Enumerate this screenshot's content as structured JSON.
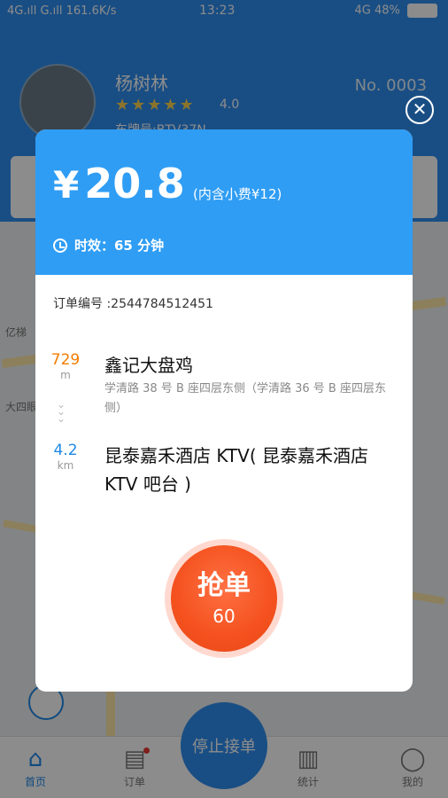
{
  "status_bar": {
    "network": "4G.ıll G.ıll 161.6K/s",
    "time": "13:23",
    "signal": "4G",
    "battery": "48%"
  },
  "driver": {
    "name": "杨树林",
    "rating": "4.0",
    "plate": "车牌号:BTV37N",
    "number": "No. 0003"
  },
  "nav": {
    "home": "首页",
    "orders": "订单",
    "stats": "统计",
    "mine": "我的",
    "stop": "停止接单"
  },
  "map_labels": {
    "a": "大四眼",
    "b": "亿梯"
  },
  "modal": {
    "currency": "¥",
    "price": "20.8",
    "tip": "(内含小费¥12)",
    "duration": "时效：65 分钟",
    "order_no": "订单编号 :2544784512451",
    "pickup": {
      "distance": "729",
      "unit": "m",
      "title": "鑫记大盘鸡",
      "address": "学清路 38 号 B 座四层东侧（学清路 36 号 B 座四层东侧）"
    },
    "dropoff": {
      "distance": "4.2",
      "unit": "km",
      "title": "昆泰嘉禾酒店 KTV( 昆泰嘉禾酒店 KTV 吧台 )"
    },
    "grab_label": "抢单",
    "grab_count": "60"
  },
  "colors": {
    "header_blue": "#2f9df4",
    "grab_orange": "#f4511e",
    "distance_orange": "#f57c00",
    "distance_blue": "#1e88e5"
  }
}
